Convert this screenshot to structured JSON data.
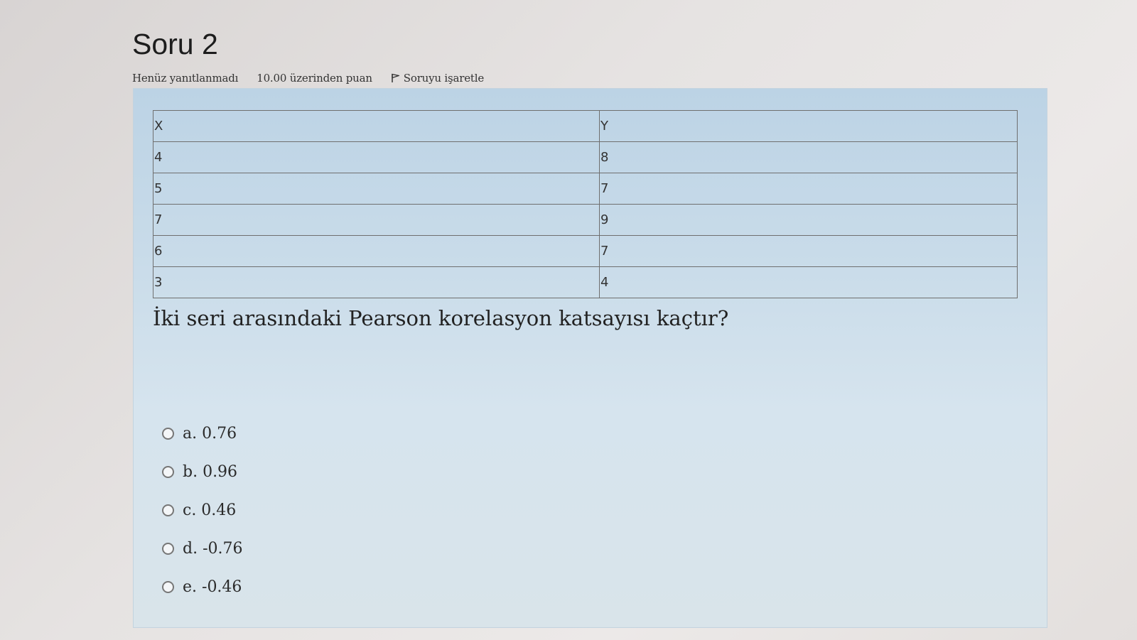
{
  "question": {
    "title": "Soru 2",
    "status": "Henüz yanıtlanmadı",
    "points": "10.00 üzerinden puan",
    "flag_label": "Soruyu işaretle",
    "table": {
      "headers": [
        "X",
        "Y"
      ],
      "rows": [
        [
          "4",
          "8"
        ],
        [
          "5",
          "7"
        ],
        [
          "7",
          "9"
        ],
        [
          "6",
          "7"
        ],
        [
          "3",
          "4"
        ]
      ]
    },
    "text": "İki seri arasındaki Pearson korelasyon katsayısı kaçtır?",
    "answers": [
      "a. 0.76",
      "b. 0.96",
      "c. 0.46",
      "d. -0.76",
      "e. -0.46"
    ]
  },
  "icons": {
    "flag": "flag-icon",
    "radio": "radio-button"
  }
}
